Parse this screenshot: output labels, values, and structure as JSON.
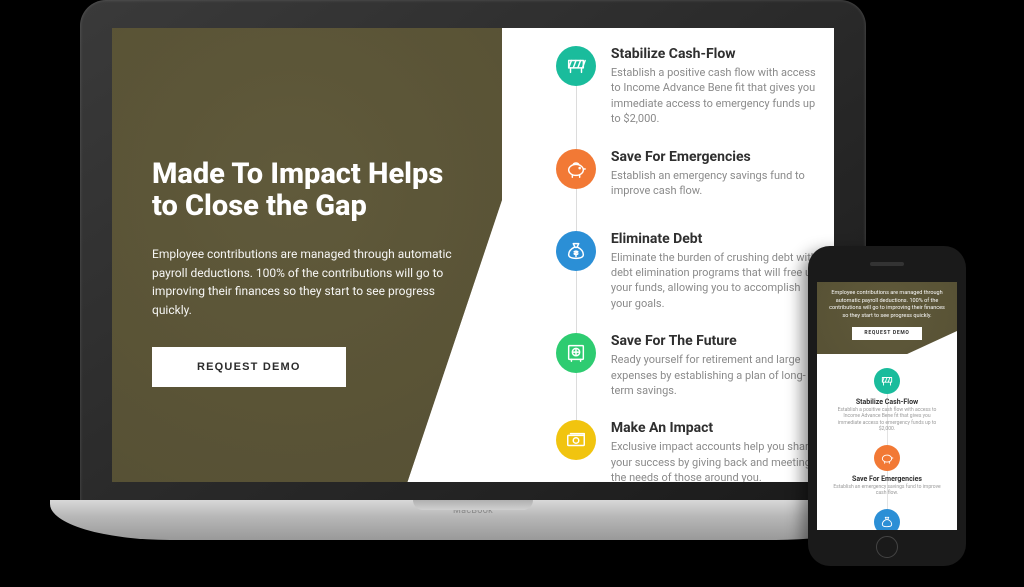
{
  "hero": {
    "heading": "Made To Impact Helps to Close the Gap",
    "body": "Employee contributions are managed through automatic payroll deductions. 100% of the contributions will go to improving their finances so they start to see progress quickly.",
    "cta": "REQUEST DEMO"
  },
  "features": [
    {
      "icon": "barrier-icon",
      "color": "teal",
      "title": "Stabilize Cash-Flow",
      "body": "Establish a positive cash  flow with access to Income Advance Bene fit that gives you immediate access to emergency funds up to $2,000."
    },
    {
      "icon": "piggybank-icon",
      "color": "orange",
      "title": "Save For Emergencies",
      "body": "Establish an emergency savings fund to improve cash  flow."
    },
    {
      "icon": "moneybag-icon",
      "color": "blue",
      "title": "Eliminate Debt",
      "body": "Eliminate the burden of crushing debt with debt elimination programs that will free up your funds, allowing you to accomplish your goals."
    },
    {
      "icon": "safe-icon",
      "color": "green",
      "title": "Save For The Future",
      "body": "Ready yourself for retirement and large expenses by establishing a plan of long-term savings."
    },
    {
      "icon": "cash-icon",
      "color": "yellow",
      "title": "Make An Impact",
      "body": "Exclusive impact accounts help you share your success by giving back and meeting the needs of those around you."
    }
  ],
  "device": {
    "laptop_label": "MacBook"
  },
  "mobile": {
    "hero_body": "Employee contributions are managed through automatic payroll deductions. 100% of the contributions will go to improving their finances so they start to see progress quickly.",
    "cta": "REQUEST DEMO"
  }
}
